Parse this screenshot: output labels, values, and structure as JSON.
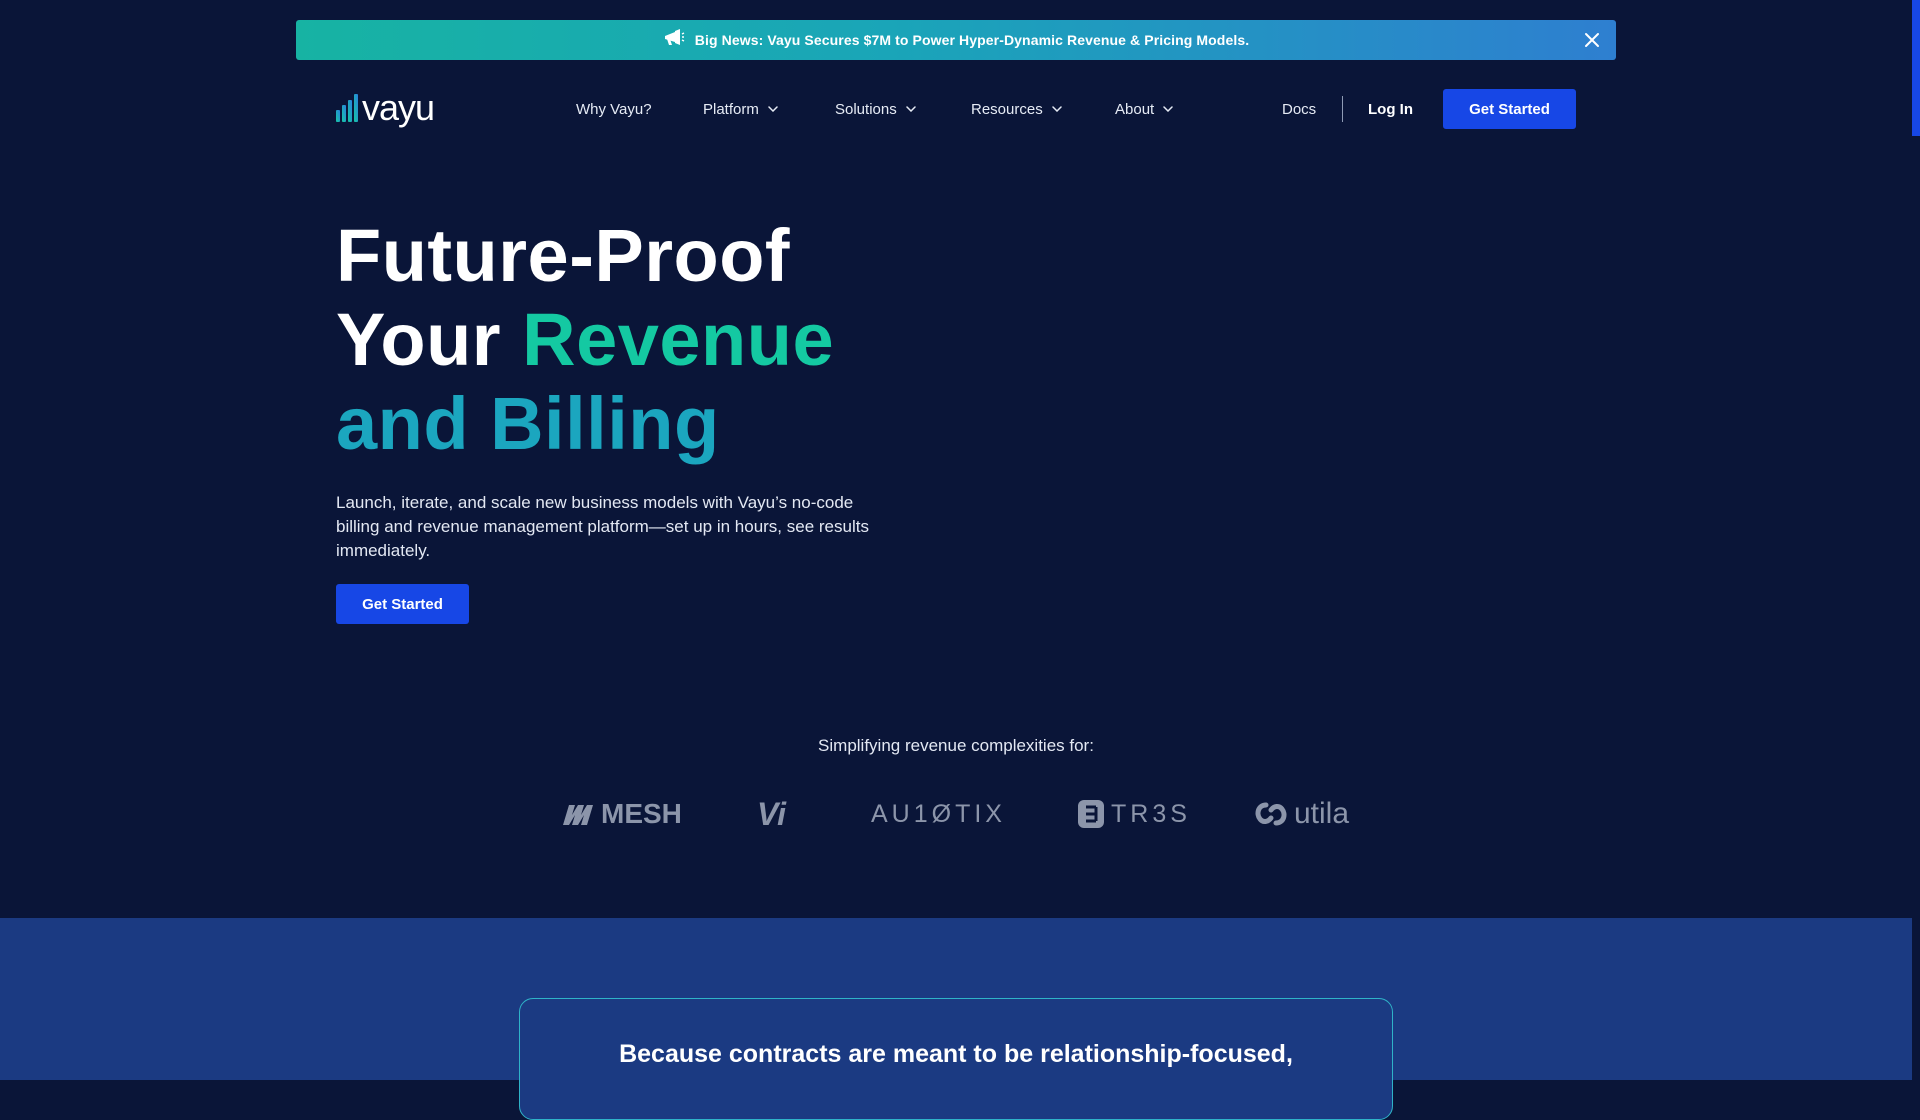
{
  "banner": {
    "text": "Big News: Vayu Secures $7M to Power Hyper-Dynamic Revenue & Pricing Models.",
    "icon": "megaphone-icon",
    "close_icon": "close-icon"
  },
  "nav": {
    "logo_text": "vayu",
    "items": [
      {
        "label": "Why Vayu?",
        "dropdown": false
      },
      {
        "label": "Platform",
        "dropdown": true
      },
      {
        "label": "Solutions",
        "dropdown": true
      },
      {
        "label": "Resources",
        "dropdown": true
      },
      {
        "label": "About",
        "dropdown": true
      }
    ],
    "docs": "Docs",
    "login": "Log In",
    "cta": "Get Started"
  },
  "hero": {
    "title_line1": "Future-Proof",
    "title_line2_a": "Your ",
    "title_line2_b": "Revenue",
    "title_line3": "and Billing",
    "subtitle": "Launch, iterate, and scale new business models with Vayu’s no-code billing and revenue management platform—set up in hours, see results immediately.",
    "cta": "Get Started"
  },
  "clients": {
    "heading": "Simplifying revenue complexities for:",
    "logos": [
      "MESH",
      "Vi",
      "AU1ØTIX",
      "TR3S",
      "utila"
    ]
  },
  "section2": {
    "quote": "Because contracts are meant to be relationship-focused,"
  },
  "colors": {
    "background": "#0a1538",
    "primary": "#1747e6",
    "accent_green": "#14c9a2",
    "accent_teal": "#1ba6bf",
    "section_blue": "#1b3a82"
  }
}
